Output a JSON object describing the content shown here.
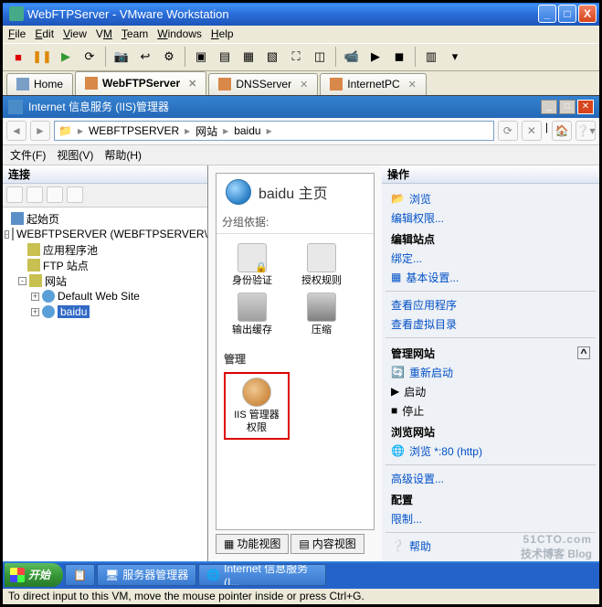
{
  "window": {
    "title": "WebFTPServer - VMware Workstation"
  },
  "menu": {
    "file": "File",
    "edit": "Edit",
    "view": "View",
    "vm": "VM",
    "team": "Team",
    "windows": "Windows",
    "help": "Help"
  },
  "vmtabs": {
    "home": "Home",
    "active": "WebFTPServer",
    "dns": "DNSServer",
    "internet": "InternetPC"
  },
  "iis": {
    "title": "Internet 信息服务 (IIS)管理器",
    "breadcrumb": [
      "WEBFTPSERVER",
      "网站",
      "baidu"
    ],
    "menu": {
      "file": "文件(F)",
      "view": "视图(V)",
      "help": "帮助(H)"
    },
    "left": {
      "header": "连接",
      "tree": {
        "start": "起始页",
        "server": "WEBFTPSERVER (WEBFTPSERVER\\Administrator)",
        "apppool": "应用程序池",
        "ftp": "FTP 站点",
        "sites": "网站",
        "default": "Default Web Site",
        "baidu": "baidu"
      }
    },
    "mid": {
      "title": "baidu 主页",
      "group": "分组依据:",
      "features": {
        "auth": "身份验证",
        "authz": "授权规则",
        "cache": "输出缓存",
        "compress": "压缩"
      },
      "mgmthdr": "管理",
      "iismgr": "IIS 管理器权限",
      "viewtabs": {
        "features": "功能视图",
        "content": "内容视图"
      }
    },
    "right": {
      "header": "操作",
      "browse": "浏览",
      "editperm": "编辑权限...",
      "editsite": "编辑站点",
      "bindings": "绑定...",
      "basic": "基本设置...",
      "viewapps": "查看应用程序",
      "viewvdir": "查看虚拟目录",
      "mngsite": "管理网站",
      "restart": "重新启动",
      "start": "启动",
      "stop": "停止",
      "browsesite": "浏览网站",
      "browse80": "浏览 *:80 (http)",
      "advanced": "高级设置...",
      "config": "配置",
      "limits": "限制...",
      "help": "帮助"
    }
  },
  "taskbar": {
    "start": "开始",
    "task1": "服务器管理器",
    "task2": "Internet 信息服务 (I..."
  },
  "watermark": {
    "main": "51CTO.com",
    "sub": "技术博客 Blog"
  },
  "footer": "To direct input to this VM, move the mouse pointer inside or press Ctrl+G."
}
